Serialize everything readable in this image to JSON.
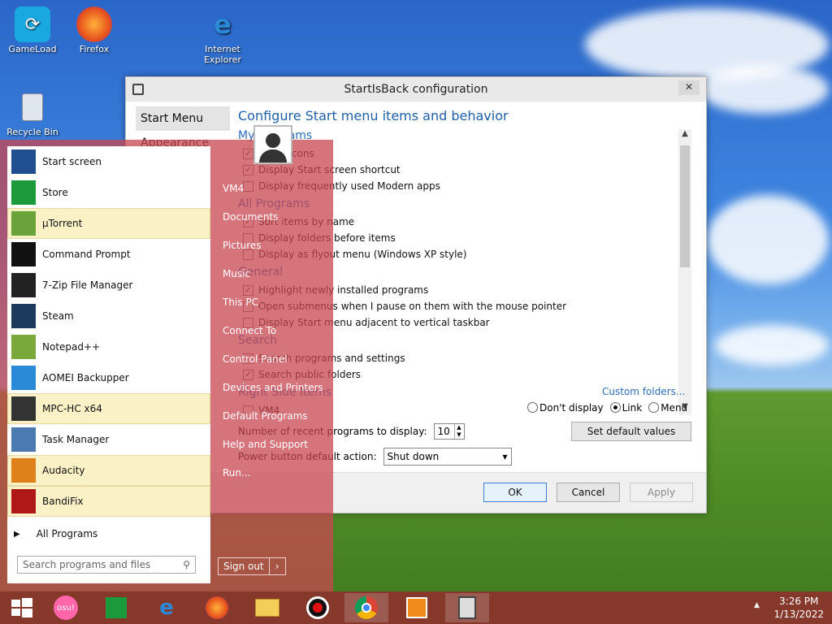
{
  "desktop": {
    "icons": [
      {
        "label": "GameLoad"
      },
      {
        "label": "Firefox"
      },
      {
        "label": "Internet Explorer"
      },
      {
        "label": "Recycle Bin"
      }
    ]
  },
  "config_window": {
    "title": "StartIsBack configuration",
    "close_label": "✕",
    "nav": [
      "Start Menu",
      "Appearance"
    ],
    "heading": "Configure Start menu items and behavior",
    "sections": [
      {
        "title": "My Programs",
        "options": [
          {
            "label": "Large icons",
            "checked": true
          },
          {
            "label": "Display Start screen shortcut",
            "checked": true
          },
          {
            "label": "Display frequently used Modern apps",
            "checked": false
          }
        ]
      },
      {
        "title": "All Programs",
        "options": [
          {
            "label": "Sort items by name",
            "checked": true
          },
          {
            "label": "Display folders before items",
            "checked": false
          },
          {
            "label": "Display as flyout menu (Windows XP style)",
            "checked": false
          }
        ]
      },
      {
        "title": "General",
        "options": [
          {
            "label": "Highlight newly installed programs",
            "checked": true
          },
          {
            "label": "Open submenus when I pause on them with the mouse pointer",
            "checked": false
          },
          {
            "label": "Display Start menu adjacent to vertical taskbar",
            "checked": false
          }
        ]
      },
      {
        "title": "Search",
        "options": [
          {
            "label": "Search programs and settings",
            "checked": true
          },
          {
            "label": "Search public folders",
            "checked": true
          }
        ]
      },
      {
        "title": "Right Side Items",
        "options": [
          {
            "label": "VM4",
            "checked": false
          }
        ]
      }
    ],
    "custom_folders": "Custom folders...",
    "radios": [
      {
        "label": "Don't display",
        "selected": false
      },
      {
        "label": "Link",
        "selected": true
      },
      {
        "label": "Menu",
        "selected": false
      }
    ],
    "recent_label": "Number of recent programs to display:",
    "recent_value": "10",
    "set_default": "Set default values",
    "power_label": "Power button default action:",
    "power_value": "Shut down",
    "ok": "OK",
    "cancel": "Cancel",
    "apply": "Apply"
  },
  "start_menu": {
    "apps": [
      {
        "label": "Start screen",
        "icon": "start-screen-icon",
        "color": "#1f4f8f",
        "highlight": false
      },
      {
        "label": "Store",
        "icon": "store-icon",
        "color": "#1a9a3a",
        "highlight": false
      },
      {
        "label": "µTorrent",
        "icon": "utorrent-icon",
        "color": "#6aa33a",
        "highlight": true
      },
      {
        "label": "Command Prompt",
        "icon": "cmd-icon",
        "color": "#111111",
        "highlight": false
      },
      {
        "label": "7-Zip File Manager",
        "icon": "7zip-icon",
        "color": "#222222",
        "highlight": false
      },
      {
        "label": "Steam",
        "icon": "steam-icon",
        "color": "#1b3a5c",
        "highlight": false
      },
      {
        "label": "Notepad++",
        "icon": "notepadpp-icon",
        "color": "#7aa83a",
        "highlight": false
      },
      {
        "label": "AOMEI Backupper",
        "icon": "aomei-icon",
        "color": "#2a8ad8",
        "highlight": false
      },
      {
        "label": "MPC-HC x64",
        "icon": "mpc-icon",
        "color": "#333333",
        "highlight": true
      },
      {
        "label": "Task Manager",
        "icon": "taskmgr-icon",
        "color": "#4a7ab0",
        "highlight": false
      },
      {
        "label": "Audacity",
        "icon": "audacity-icon",
        "color": "#e0801a",
        "highlight": true
      },
      {
        "label": "BandiFix",
        "icon": "bandifix-icon",
        "color": "#b01818",
        "highlight": true
      }
    ],
    "all_programs": "All Programs",
    "search_placeholder": "Search programs and files",
    "right_items": [
      "VM4",
      "Documents",
      "Pictures",
      "Music",
      "This PC",
      "Connect To",
      "Control Panel",
      "Devices and Printers",
      "Default Programs",
      "Help and Support",
      "Run..."
    ],
    "sign_out": "Sign out"
  },
  "taskbar": {
    "time": "3:26 PM",
    "date": "1/13/2022",
    "osu_label": "osu!"
  }
}
